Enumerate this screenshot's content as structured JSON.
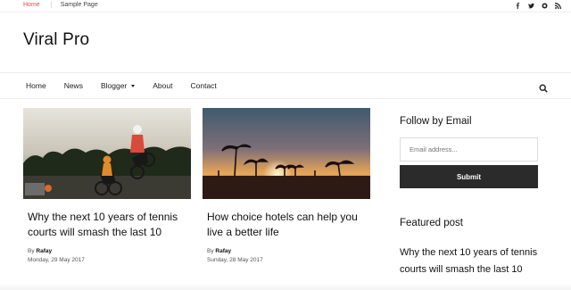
{
  "topbar": {
    "links": [
      "Home",
      "Sample Page"
    ],
    "social_icons": [
      "facebook-icon",
      "twitter-icon",
      "ring-icon",
      "rss-icon"
    ]
  },
  "site": {
    "title": "Viral Pro"
  },
  "nav": {
    "items": [
      "Home",
      "News",
      "Blogger",
      "About",
      "Contact"
    ],
    "search_icon": "search-icon"
  },
  "posts": [
    {
      "title": "Why the next 10 years of tennis courts will smash the last 10",
      "by": "By",
      "author": "Rafay",
      "date": "Monday, 29 May 2017"
    },
    {
      "title": "How choice hotels can help you live a better life",
      "by": "By",
      "author": "Rafay",
      "date": "Sunday, 28 May 2017"
    }
  ],
  "sidebar": {
    "follow_title": "Follow by Email",
    "email_placeholder": "Email address...",
    "submit_label": "Submit",
    "featured_title": "Featured post",
    "featured_post": "Why the next 10 years of tennis courts will smash the last 10"
  },
  "colors": {
    "accent": "#d9534f",
    "button": "#2b2b2b"
  }
}
